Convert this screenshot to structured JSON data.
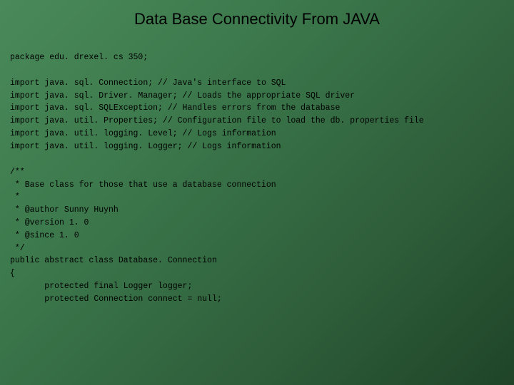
{
  "title": "Data Base Connectivity From JAVA",
  "code": {
    "package_line": "package edu. drexel. cs 350;",
    "imports": [
      "import java. sql. Connection; // Java's interface to SQL",
      "import java. sql. Driver. Manager; // Loads the appropriate SQL driver",
      "import java. sql. SQLException; // Handles errors from the database",
      "import java. util. Properties; // Configuration file to load the db. properties file",
      "import java. util. logging. Level; // Logs information",
      "import java. util. logging. Logger; // Logs information"
    ],
    "javadoc": [
      "/**",
      " * Base class for those that use a database connection",
      " *",
      " * @author Sunny Huynh",
      " * @version 1. 0",
      " * @since 1. 0",
      " */"
    ],
    "class_decl": "public abstract class Database. Connection",
    "brace": "{",
    "body": [
      "       protected final Logger logger;",
      "       protected Connection connect = null;"
    ]
  }
}
